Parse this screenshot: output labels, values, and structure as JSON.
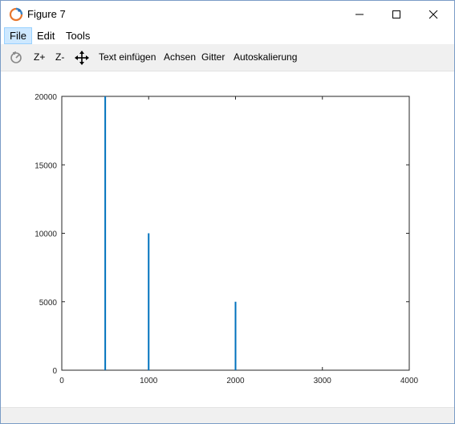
{
  "window": {
    "title": "Figure 7"
  },
  "menu": {
    "items": [
      "File",
      "Edit",
      "Tools"
    ]
  },
  "toolbar": {
    "zoom_in": "Z+",
    "zoom_out": "Z-",
    "insert_text": "Text einfügen",
    "axes": "Achsen",
    "grid": "Gitter",
    "autoscale": "Autoskalierung"
  },
  "colors": {
    "series": "#0072bd",
    "axis": "#262626"
  },
  "chart_data": {
    "type": "bar",
    "x": [
      500,
      1000,
      2000
    ],
    "values": [
      20000,
      10000,
      5000
    ],
    "xlim": [
      0,
      4000
    ],
    "ylim": [
      0,
      20000
    ],
    "xticks": [
      0,
      1000,
      2000,
      3000,
      4000
    ],
    "yticks": [
      0,
      5000,
      10000,
      15000,
      20000
    ],
    "title": "",
    "xlabel": "",
    "ylabel": "",
    "grid": false
  }
}
